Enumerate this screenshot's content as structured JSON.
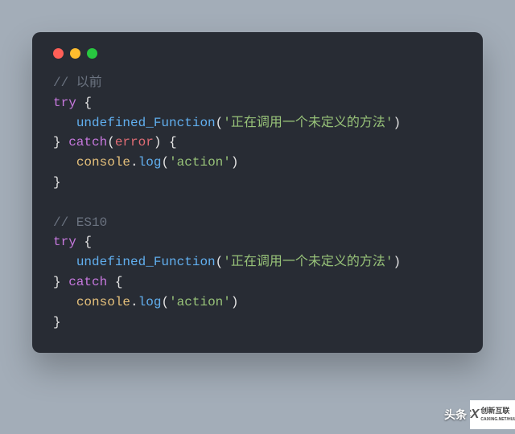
{
  "traffic_lights": {
    "red": "#ff5f57",
    "yellow": "#febc2e",
    "green": "#28c840"
  },
  "code": {
    "l1_comment": "// 以前",
    "l2_try": "try",
    "l2_brace": " {",
    "l3_indent": "   ",
    "l3_fn": "undefined_Function",
    "l3_open": "(",
    "l3_str": "'正在调用一个未定义的方法'",
    "l3_close": ")",
    "l4_close": "} ",
    "l4_catch": "catch",
    "l4_paren_open": "(",
    "l4_err": "error",
    "l4_paren_close": ") {",
    "l5_indent": "   ",
    "l5_obj": "console",
    "l5_dot": ".",
    "l5_fn": "log",
    "l5_open": "(",
    "l5_str": "'action'",
    "l5_close": ")",
    "l6_close": "}",
    "blank": "",
    "l8_comment": "// ES10",
    "l9_try": "try",
    "l9_brace": " {",
    "l10_indent": "   ",
    "l10_fn": "undefined_Function",
    "l10_open": "(",
    "l10_str": "'正在调用一个未定义的方法'",
    "l10_close": ")",
    "l11_close": "} ",
    "l11_catch": "catch",
    "l11_brace": " {",
    "l12_indent": "   ",
    "l12_obj": "console",
    "l12_dot": ".",
    "l12_fn": "log",
    "l12_open": "(",
    "l12_str": "'action'",
    "l12_close": ")",
    "l13_close": "}"
  },
  "watermark": {
    "text": "头条",
    "logo_big": "CX",
    "logo_small_top": "创新互联",
    "logo_small_bot": "CAIXING.NET/HULIAN"
  }
}
